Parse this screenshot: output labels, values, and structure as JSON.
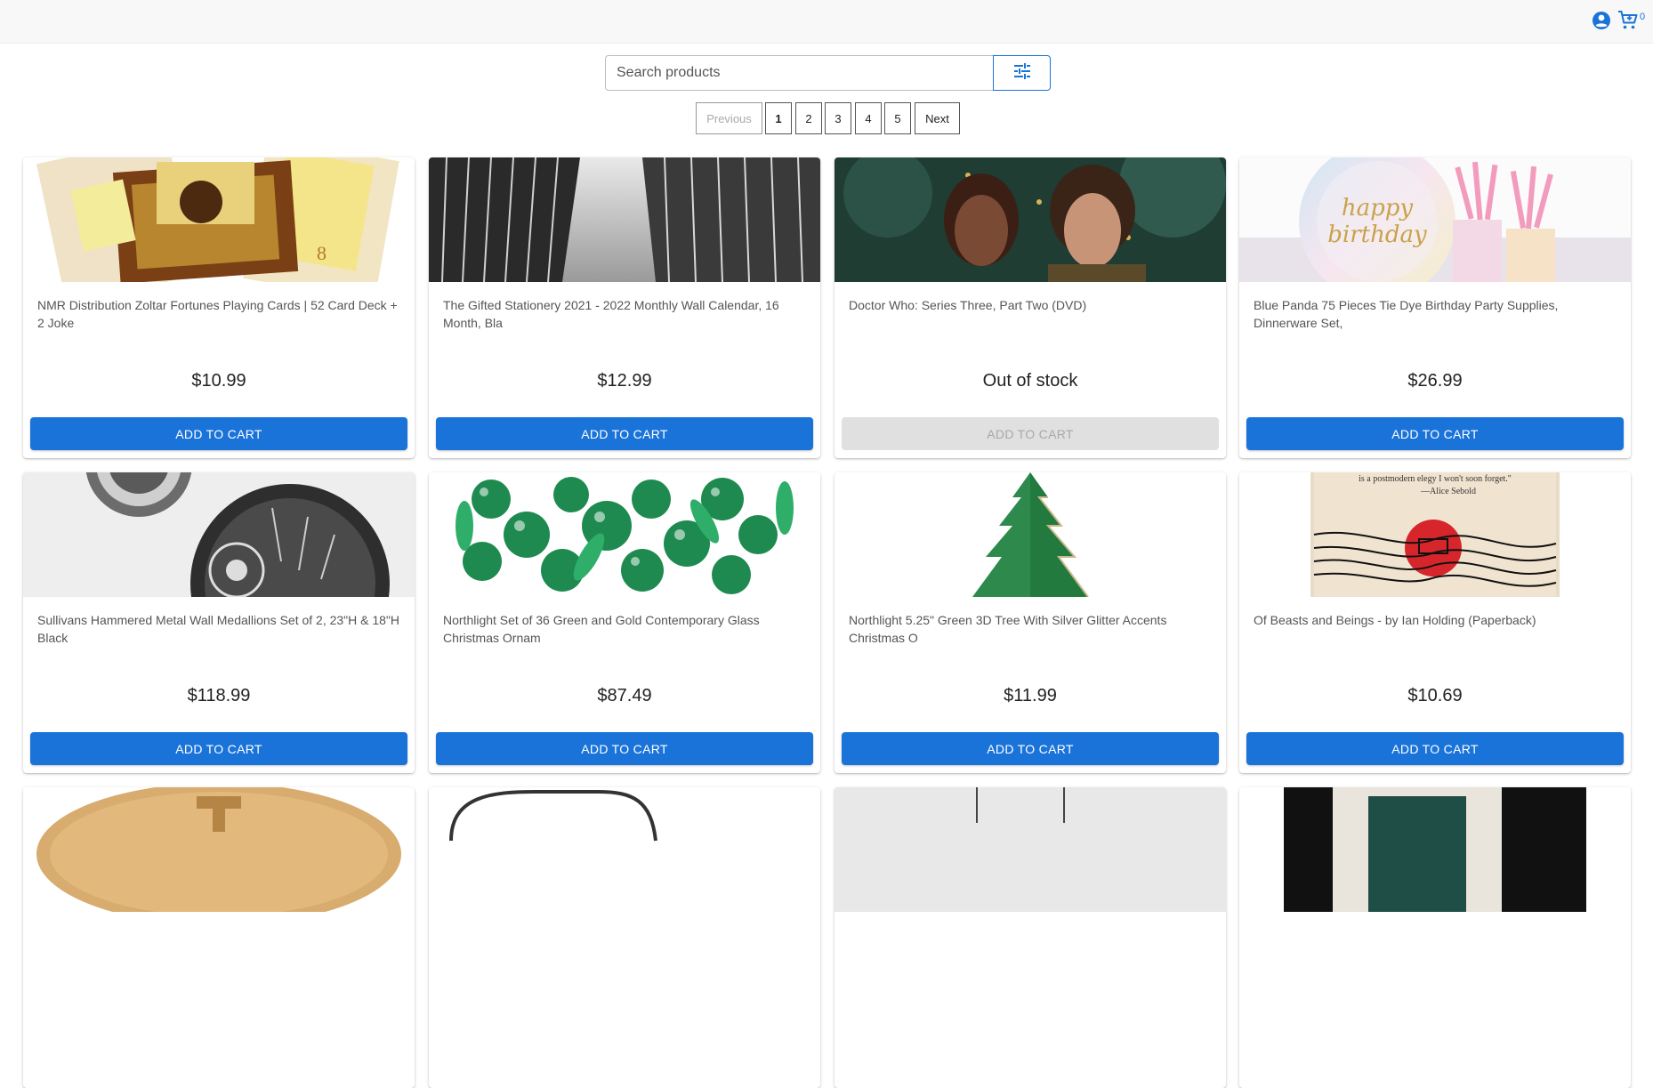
{
  "header": {
    "account_icon": "account-circle-icon",
    "cart_icon": "shopping-cart-icon",
    "cart_count": "0"
  },
  "search": {
    "placeholder": "Search products",
    "value": "",
    "filter_icon": "tune-filter-icon"
  },
  "pagination": {
    "previous_label": "Previous",
    "pages": [
      "1",
      "2",
      "3",
      "4",
      "5"
    ],
    "current_page": "1",
    "next_label": "Next"
  },
  "products": [
    {
      "title": "NMR Distribution Zoltar Fortunes Playing Cards | 52 Card Deck + 2 Joke",
      "price": "$10.99",
      "button": "ADD TO CART",
      "in_stock": true
    },
    {
      "title": "The Gifted Stationery 2021 - 2022 Monthly Wall Calendar, 16 Month, Bla",
      "price": "$12.99",
      "button": "ADD TO CART",
      "in_stock": true
    },
    {
      "title": "Doctor Who: Series Three, Part Two (DVD)",
      "price": "Out of stock",
      "button": "ADD TO CART",
      "in_stock": false
    },
    {
      "title": "Blue Panda 75 Pieces Tie Dye Birthday Party Supplies, Dinnerware Set,",
      "price": "$26.99",
      "button": "ADD TO CART",
      "in_stock": true,
      "image_text": [
        "happy",
        "birthday"
      ]
    },
    {
      "title": "Sullivans Hammered Metal Wall Medallions Set of 2, 23\"H & 18\"H Black",
      "price": "$118.99",
      "button": "ADD TO CART",
      "in_stock": true
    },
    {
      "title": "Northlight Set of 36 Green and Gold Contemporary Glass Christmas Ornam",
      "price": "$87.49",
      "button": "ADD TO CART",
      "in_stock": true
    },
    {
      "title": "Northlight 5.25\" Green 3D Tree With Silver Glitter Accents Christmas O",
      "price": "$11.99",
      "button": "ADD TO CART",
      "in_stock": true
    },
    {
      "title": "Of Beasts and Beings - by Ian Holding (Paperback)",
      "price": "$10.69",
      "button": "ADD TO CART",
      "in_stock": true,
      "image_text": [
        "is a postmodern elegy I won't soon forget.\"",
        "—Alice Sebold"
      ]
    }
  ],
  "colors": {
    "primary": "#1a73d9",
    "disabled_button": "#e0e0e0",
    "header_bg": "#f8f8f8"
  }
}
